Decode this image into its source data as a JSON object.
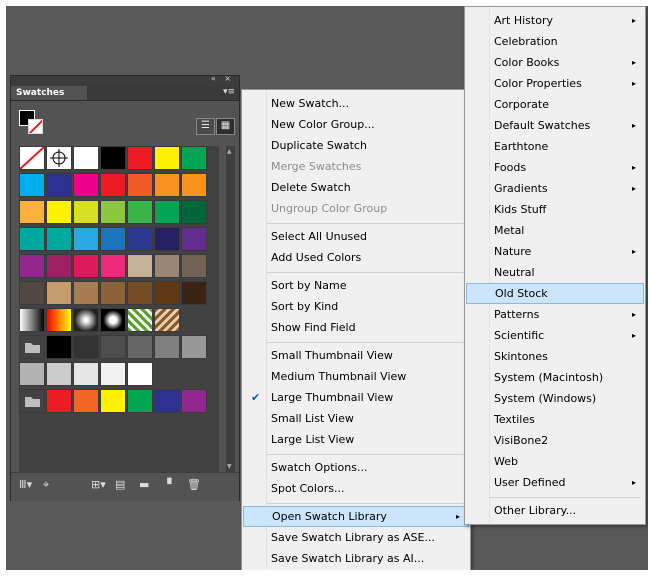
{
  "panel": {
    "title": "Swatches",
    "collapse_glyph": "«  ×",
    "menu_glyph": "▾≡",
    "list_view_glyph": "☰",
    "thumb_view_glyph": "▦"
  },
  "swatch_rows": [
    [
      "none",
      "#ffffff",
      "#ffffff",
      "#000000",
      "#ed1c24",
      "#fff200",
      "#00a651"
    ],
    [
      "#00aeef",
      "#2e3192",
      "#ec008c",
      "#ed1c24",
      "#f15a29",
      "#f7941d",
      "#f7941d"
    ],
    [
      "#fbb040",
      "#fff200",
      "#d7df23",
      "#8dc63f",
      "#39b54a",
      "#00a651",
      "#006838"
    ],
    [
      "#00a79d",
      "#00a99d",
      "#27aae1",
      "#1c75bc",
      "#2b3990",
      "#262262",
      "#662d91"
    ],
    [
      "#92278f",
      "#9e1f63",
      "#da1c5c",
      "#ee2a7b",
      "#c7b299",
      "#998675",
      "#736357"
    ],
    [
      "#534741",
      "#c69c6d",
      "#a67c52",
      "#8c6239",
      "#754c24",
      "#603913",
      "#3c2415"
    ],
    [
      "grad1",
      "grad2",
      "grad3",
      "grad4",
      "pattern1",
      "pattern2",
      ""
    ],
    [
      "folder",
      "#000000",
      "#333333",
      "#4d4d4d",
      "#666666",
      "#808080",
      "#999999"
    ],
    [
      "#b3b3b3",
      "#cccccc",
      "#e6e6e6",
      "#f2f2f2",
      "#ffffff",
      "",
      ""
    ],
    [
      "folder",
      "#ed1c24",
      "#f26522",
      "#fff200",
      "#00a651",
      "#2e3192",
      "#92278f"
    ]
  ],
  "bottom_icons": [
    "library-icon",
    "show-kinds-icon",
    "swatch-options-icon",
    "color-group-icon",
    "new-folder-icon",
    "new-swatch-icon",
    "delete-icon"
  ],
  "bottom_glyphs": [
    "Ⅲ▾",
    "⌖",
    "⊞▾",
    "▤",
    "▬",
    "▝",
    "🗑"
  ],
  "main_menu": [
    {
      "label": "New Swatch...",
      "type": "item"
    },
    {
      "label": "New Color Group...",
      "type": "item"
    },
    {
      "label": "Duplicate Swatch",
      "type": "item"
    },
    {
      "label": "Merge Swatches",
      "type": "item",
      "disabled": true
    },
    {
      "label": "Delete Swatch",
      "type": "item"
    },
    {
      "label": "Ungroup Color Group",
      "type": "item",
      "disabled": true
    },
    {
      "type": "sep"
    },
    {
      "label": "Select All Unused",
      "type": "item"
    },
    {
      "label": "Add Used Colors",
      "type": "item"
    },
    {
      "type": "sep"
    },
    {
      "label": "Sort by Name",
      "type": "item"
    },
    {
      "label": "Sort by Kind",
      "type": "item"
    },
    {
      "label": "Show Find Field",
      "type": "item"
    },
    {
      "type": "sep"
    },
    {
      "label": "Small Thumbnail View",
      "type": "item"
    },
    {
      "label": "Medium Thumbnail View",
      "type": "item"
    },
    {
      "label": "Large Thumbnail View",
      "type": "item",
      "checked": true
    },
    {
      "label": "Small List View",
      "type": "item"
    },
    {
      "label": "Large List View",
      "type": "item"
    },
    {
      "type": "sep"
    },
    {
      "label": "Swatch Options...",
      "type": "item"
    },
    {
      "label": "Spot Colors...",
      "type": "item"
    },
    {
      "type": "sep"
    },
    {
      "label": "Open Swatch Library",
      "type": "item",
      "submenu": true,
      "highlighted": true
    },
    {
      "label": "Save Swatch Library as ASE...",
      "type": "item"
    },
    {
      "label": "Save Swatch Library as AI...",
      "type": "item"
    }
  ],
  "sub_menu": [
    {
      "label": "Art History",
      "submenu": true
    },
    {
      "label": "Celebration"
    },
    {
      "label": "Color Books",
      "submenu": true
    },
    {
      "label": "Color Properties",
      "submenu": true
    },
    {
      "label": "Corporate"
    },
    {
      "label": "Default Swatches",
      "submenu": true
    },
    {
      "label": "Earthtone"
    },
    {
      "label": "Foods",
      "submenu": true
    },
    {
      "label": "Gradients",
      "submenu": true
    },
    {
      "label": "Kids Stuff"
    },
    {
      "label": "Metal"
    },
    {
      "label": "Nature",
      "submenu": true
    },
    {
      "label": "Neutral"
    },
    {
      "label": "Old Stock",
      "highlighted": true
    },
    {
      "label": "Patterns",
      "submenu": true
    },
    {
      "label": "Scientific",
      "submenu": true
    },
    {
      "label": "Skintones"
    },
    {
      "label": "System (Macintosh)"
    },
    {
      "label": "System (Windows)"
    },
    {
      "label": "Textiles"
    },
    {
      "label": "VisiBone2"
    },
    {
      "label": "Web"
    },
    {
      "label": "User Defined",
      "submenu": true
    },
    {
      "type": "sep"
    },
    {
      "label": "Other Library..."
    }
  ],
  "glyphs": {
    "arrow": "▸",
    "check": "✔",
    "scroll_up": "▲",
    "scroll_down": "▼"
  }
}
